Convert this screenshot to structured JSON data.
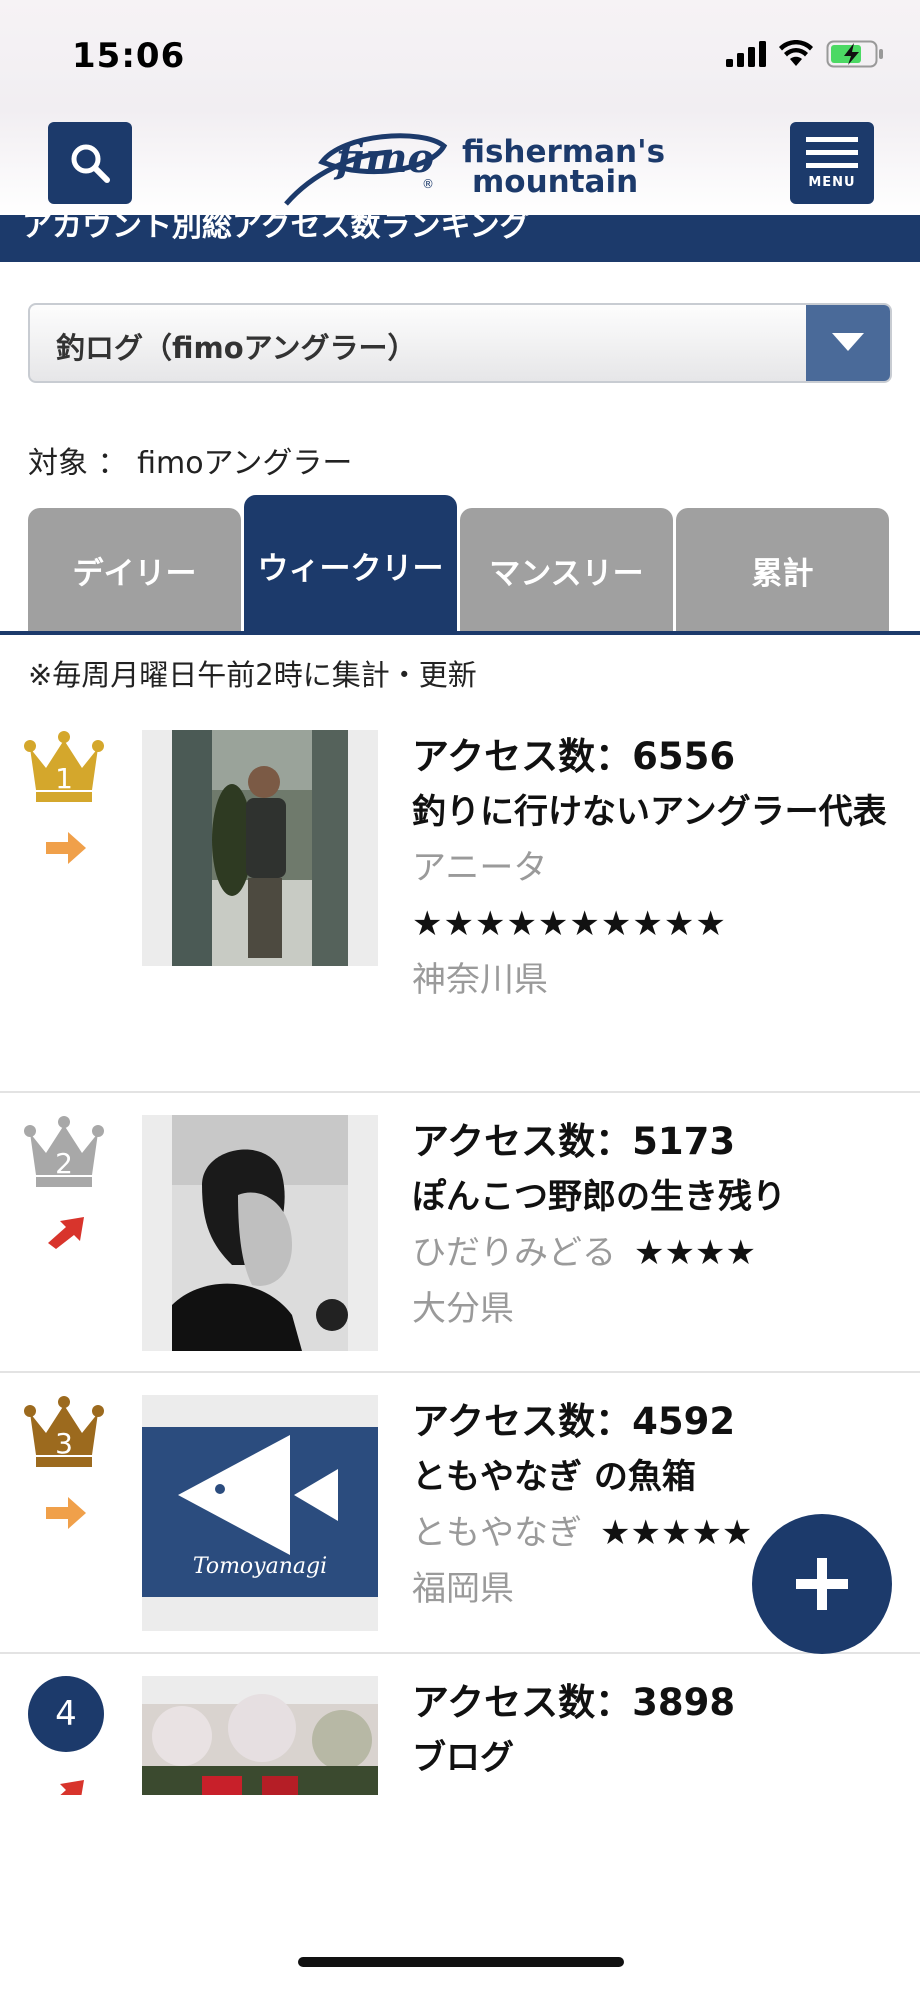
{
  "status": {
    "time": "15:06"
  },
  "header": {
    "logo_script": "fimo",
    "logo_line1": "fisherman's",
    "logo_line2": "mountain",
    "menu_label": "MENU"
  },
  "title_band": "アカウント別総アクセス数ランキング",
  "dropdown": {
    "value": "釣ログ（fimoアングラー）"
  },
  "target_label": "対象 ： fimoアングラー",
  "tabs": [
    {
      "label": "デイリー",
      "active": false
    },
    {
      "label": "ウィークリー",
      "active": true
    },
    {
      "label": "マンスリー",
      "active": false
    },
    {
      "label": "累計",
      "active": false
    }
  ],
  "update_note": "※毎周月曜日午前2時に集計・更新",
  "ranking": [
    {
      "rank": "1",
      "trend": "same",
      "access": "アクセス数：6556",
      "title": "釣りに行けないアングラー代表",
      "author": "アニータ",
      "stars": "★★★★★★★★★★",
      "prefecture": "神奈川県"
    },
    {
      "rank": "2",
      "trend": "up",
      "access": "アクセス数：5173",
      "title": "ぽんこつ野郎の生き残り",
      "author": "ひだりみどる",
      "stars": "★★★★",
      "prefecture": "大分県"
    },
    {
      "rank": "3",
      "trend": "same",
      "access": "アクセス数：4592",
      "title": "ともやなぎ の魚箱",
      "author": "ともやなぎ",
      "stars": "★★★★★",
      "prefecture": "福岡県",
      "thumb_text": "Tomoyanagi"
    },
    {
      "rank": "4",
      "trend": "up",
      "access": "アクセス数：3898",
      "title": "ブログ"
    }
  ],
  "colors": {
    "brand_navy": "#1c3a6b",
    "gold": "#c9a227",
    "silver": "#a8a8a8",
    "bronze": "#9c6a1e",
    "trend_same": "#f0a04a",
    "trend_up": "#d8342c"
  }
}
